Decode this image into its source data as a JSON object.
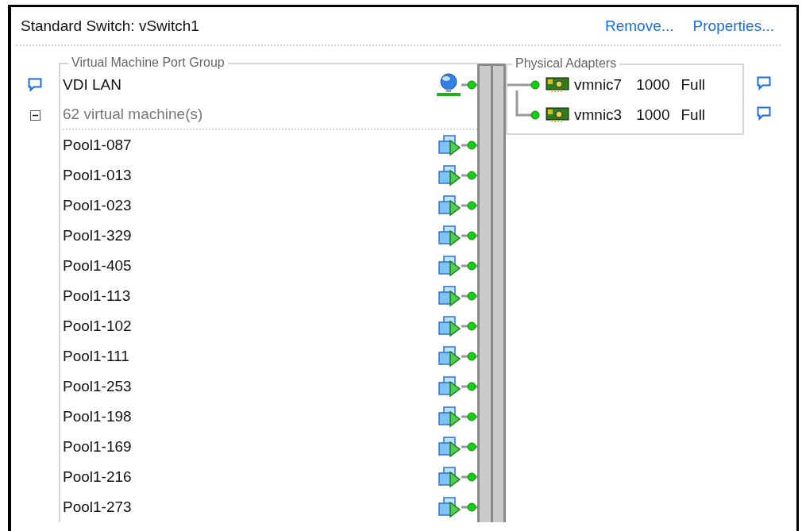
{
  "header": {
    "title": "Standard Switch: vSwitch1",
    "links": [
      "Remove...",
      "Properties..."
    ]
  },
  "port_group": {
    "legend": "Virtual Machine Port Group",
    "name": "VDI LAN",
    "vm_summary": {
      "text": "62 virtual machine(s)",
      "expanded": true
    },
    "vms": [
      "Pool1-087",
      "Pool1-013",
      "Pool1-023",
      "Pool1-329",
      "Pool1-405",
      "Pool1-113",
      "Pool1-102",
      "Pool1-111",
      "Pool1-253",
      "Pool1-198",
      "Pool1-169",
      "Pool1-216",
      "Pool1-273"
    ]
  },
  "physical_adapters": {
    "legend": "Physical Adapters",
    "adapters": [
      {
        "name": "vmnic7",
        "speed": "1000",
        "duplex": "Full"
      },
      {
        "name": "vmnic3",
        "speed": "1000",
        "duplex": "Full"
      }
    ]
  }
}
